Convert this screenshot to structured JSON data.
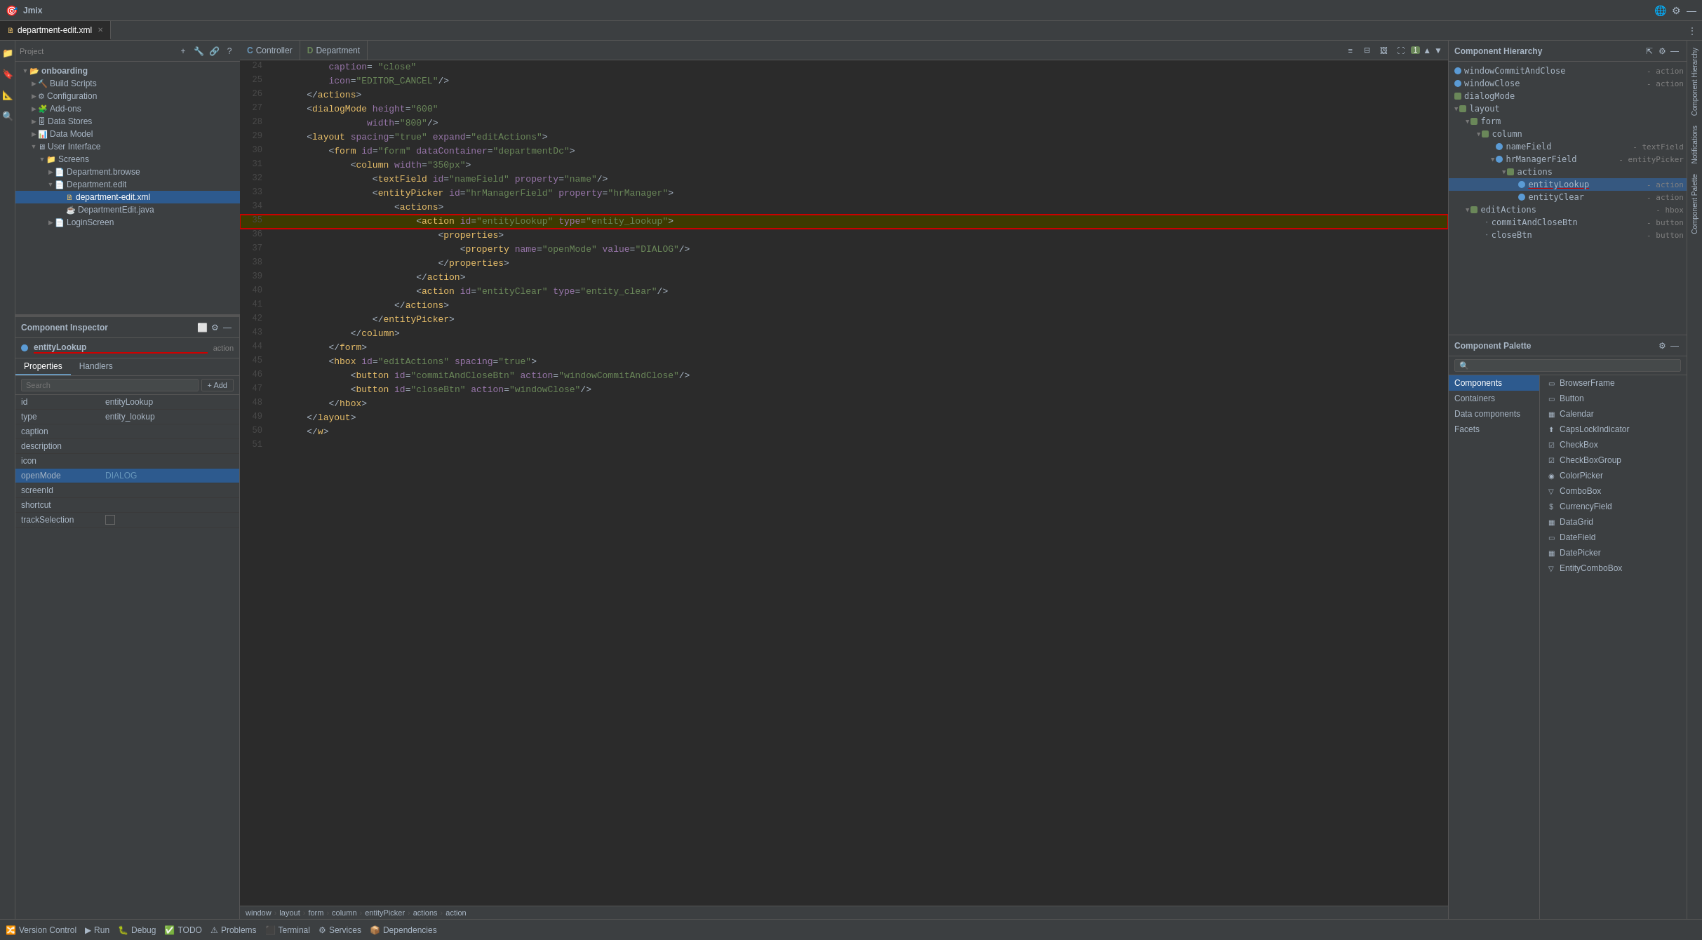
{
  "app": {
    "title": "Jmix",
    "tab_title": "department-edit.xml"
  },
  "top_bar": {
    "title": "Jmix",
    "buttons": [
      "globe-icon",
      "settings-icon",
      "close-icon"
    ]
  },
  "editor_tabs": [
    {
      "label": "Controller",
      "icon": "C",
      "active": false
    },
    {
      "label": "Department",
      "icon": "D",
      "active": false
    }
  ],
  "left_sidebar_icons": [
    "project-icon",
    "bookmark-icon",
    "structure-icon",
    "inspector-icon"
  ],
  "right_sidebar_labels": [
    "Component Hierarchy",
    "Notifications",
    "Component Palette"
  ],
  "project_panel": {
    "title": "Project",
    "toolbar_buttons": [
      "+",
      "wrench",
      "chain",
      "?"
    ],
    "tree": [
      {
        "id": "onboarding",
        "label": "onboarding",
        "level": 0,
        "expanded": true,
        "icon": "folder",
        "bold": true
      },
      {
        "id": "build-scripts",
        "label": "Build Scripts",
        "level": 1,
        "expanded": false,
        "icon": "build"
      },
      {
        "id": "configuration",
        "label": "Configuration",
        "level": 1,
        "expanded": false,
        "icon": "config"
      },
      {
        "id": "add-ons",
        "label": "Add-ons",
        "level": 1,
        "expanded": false,
        "icon": "addon"
      },
      {
        "id": "data-stores",
        "label": "Data Stores",
        "level": 1,
        "expanded": false,
        "icon": "db"
      },
      {
        "id": "data-model",
        "label": "Data Model",
        "level": 1,
        "expanded": false,
        "icon": "model"
      },
      {
        "id": "user-interface",
        "label": "User Interface",
        "level": 1,
        "expanded": true,
        "icon": "ui"
      },
      {
        "id": "screens",
        "label": "Screens",
        "level": 2,
        "expanded": true,
        "icon": "folder"
      },
      {
        "id": "department-browse",
        "label": "Department.browse",
        "level": 3,
        "expanded": false,
        "icon": "screen"
      },
      {
        "id": "department-edit",
        "label": "Department.edit",
        "level": 3,
        "expanded": true,
        "icon": "screen"
      },
      {
        "id": "department-edit-xml",
        "label": "department-edit.xml",
        "level": 4,
        "icon": "xml",
        "selected": true
      },
      {
        "id": "department-edit-java",
        "label": "DepartmentEdit.java",
        "level": 4,
        "icon": "java"
      },
      {
        "id": "login-screen",
        "label": "LoginScreen",
        "level": 3,
        "expanded": false,
        "icon": "screen"
      }
    ]
  },
  "component_inspector": {
    "title": "Component Inspector",
    "component_name": "entityLookup",
    "component_type": "action",
    "tabs": [
      "Properties",
      "Handlers"
    ],
    "active_tab": "Properties",
    "search_placeholder": "Search",
    "add_label": "+ Add",
    "properties": [
      {
        "name": "id",
        "value": "entityLookup",
        "selected": false
      },
      {
        "name": "type",
        "value": "entity_lookup",
        "selected": false
      },
      {
        "name": "caption",
        "value": "",
        "selected": false
      },
      {
        "name": "description",
        "value": "",
        "selected": false
      },
      {
        "name": "icon",
        "value": "",
        "selected": false
      },
      {
        "name": "openMode",
        "value": "DIALOG",
        "selected": true
      },
      {
        "name": "screenId",
        "value": "",
        "selected": false
      },
      {
        "name": "shortcut",
        "value": "",
        "selected": false
      },
      {
        "name": "trackSelection",
        "value": "checkbox",
        "selected": false
      }
    ]
  },
  "code_editor": {
    "file": "department-edit.xml",
    "toolbar_icons": [
      "list-icon",
      "columns-icon",
      "image-icon",
      "zoom-icon"
    ],
    "badge_count": "1",
    "lines": [
      {
        "num": 24,
        "code": "        caption= \"close\"",
        "highlight": false
      },
      {
        "num": 25,
        "code": "        icon=\"EDITOR_CANCEL\"/>",
        "highlight": false
      },
      {
        "num": 26,
        "code": "    </actions>",
        "highlight": false
      },
      {
        "num": 27,
        "code": "    <dialogMode height=\"600\"",
        "highlight": false
      },
      {
        "num": 28,
        "code": "               width=\"800\"/>",
        "highlight": false
      },
      {
        "num": 29,
        "code": "    <layout spacing=\"true\" expand=\"editActions\">",
        "highlight": false
      },
      {
        "num": 30,
        "code": "        <form id=\"form\" dataContainer=\"departmentDc\">",
        "highlight": false
      },
      {
        "num": 31,
        "code": "            <column width=\"350px\">",
        "highlight": false
      },
      {
        "num": 32,
        "code": "                <textField id=\"nameField\" property=\"name\"/>",
        "highlight": false
      },
      {
        "num": 33,
        "code": "                <entityPicker id=\"hrManagerField\" property=\"hrManager\">",
        "highlight": false
      },
      {
        "num": 34,
        "code": "                    <actions>",
        "highlight": false
      },
      {
        "num": 35,
        "code": "                        <action id=\"entityLookup\" type=\"entity_lookup\">",
        "highlight": true,
        "highlight_type": "yellow"
      },
      {
        "num": 36,
        "code": "                            <properties>",
        "highlight": false
      },
      {
        "num": 37,
        "code": "                                <property name=\"openMode\" value=\"DIALOG\"/>",
        "highlight": false
      },
      {
        "num": 38,
        "code": "                            </properties>",
        "highlight": false
      },
      {
        "num": 39,
        "code": "                        </action>",
        "highlight": false
      },
      {
        "num": 40,
        "code": "                        <action id=\"entityClear\" type=\"entity_clear\"/>",
        "highlight": false
      },
      {
        "num": 41,
        "code": "                    </actions>",
        "highlight": false
      },
      {
        "num": 42,
        "code": "                </entityPicker>",
        "highlight": false
      },
      {
        "num": 43,
        "code": "            </column>",
        "highlight": false
      },
      {
        "num": 44,
        "code": "        </form>",
        "highlight": false
      },
      {
        "num": 45,
        "code": "        <hbox id=\"editActions\" spacing=\"true\">",
        "highlight": false
      },
      {
        "num": 46,
        "code": "            <button id=\"commitAndCloseBtn\" action=\"windowCommitAndClose\"/>",
        "highlight": false
      },
      {
        "num": 47,
        "code": "            <button id=\"closeBtn\" action=\"windowClose\"/>",
        "highlight": false
      },
      {
        "num": 48,
        "code": "        </hbox>",
        "highlight": false
      },
      {
        "num": 49,
        "code": "    </layout>",
        "highlight": false
      },
      {
        "num": 50,
        "code": "    </w>",
        "highlight": false
      },
      {
        "num": 51,
        "code": "",
        "highlight": false
      }
    ]
  },
  "breadcrumb": {
    "items": [
      "window",
      "layout",
      "form",
      "column",
      "entityPicker",
      "actions",
      "action"
    ]
  },
  "component_hierarchy": {
    "title": "Component Hierarchy",
    "items": [
      {
        "id": "windowCommitAndClose",
        "label": "windowCommitAndClose",
        "type": "action",
        "level": 0,
        "dot": "blue"
      },
      {
        "id": "windowClose",
        "label": "windowClose",
        "type": "action",
        "level": 0,
        "dot": "blue"
      },
      {
        "id": "dialogMode",
        "label": "dialogMode",
        "type": "",
        "level": 0,
        "dot": "square"
      },
      {
        "id": "layout",
        "label": "layout",
        "type": "",
        "level": 0,
        "expanded": true,
        "dot": "square"
      },
      {
        "id": "form",
        "label": "form",
        "type": "",
        "level": 1,
        "expanded": true,
        "dot": "square"
      },
      {
        "id": "column",
        "label": "column",
        "type": "",
        "level": 2,
        "expanded": true,
        "dot": "square"
      },
      {
        "id": "nameField",
        "label": "nameField",
        "type": "textField",
        "level": 3,
        "dot": "blue"
      },
      {
        "id": "hrManagerField",
        "label": "hrManagerField",
        "type": "entityPicker",
        "level": 3,
        "expanded": true,
        "dot": "blue"
      },
      {
        "id": "actions",
        "label": "actions",
        "type": "",
        "level": 4,
        "expanded": true,
        "dot": "square"
      },
      {
        "id": "entityLookup",
        "label": "entityLookup",
        "type": "action",
        "level": 5,
        "dot": "blue",
        "selected": true
      },
      {
        "id": "entityClear",
        "label": "entityClear",
        "type": "action",
        "level": 5,
        "dot": "blue"
      },
      {
        "id": "editActions",
        "label": "editActions",
        "type": "hbox",
        "level": 1,
        "expanded": true,
        "dot": "square"
      },
      {
        "id": "commitAndCloseBtn",
        "label": "commitAndCloseBtn",
        "type": "button",
        "level": 2,
        "dot": "blue"
      },
      {
        "id": "closeBtn",
        "label": "closeBtn",
        "type": "button",
        "level": 2,
        "dot": "blue"
      }
    ]
  },
  "component_palette": {
    "title": "Component Palette",
    "search_placeholder": "🔍",
    "categories": [
      "Components",
      "Containers",
      "Data components",
      "Facets"
    ],
    "active_category": "Components",
    "components": [
      {
        "id": "BrowserFrame",
        "label": "BrowserFrame",
        "icon": "▭"
      },
      {
        "id": "Button",
        "label": "Button",
        "icon": "▭"
      },
      {
        "id": "Calendar",
        "label": "Calendar",
        "icon": "▦"
      },
      {
        "id": "CapsLockIndicator",
        "label": "CapsLockIndicator",
        "icon": "⬆"
      },
      {
        "id": "CheckBox",
        "label": "CheckBox",
        "icon": "☑"
      },
      {
        "id": "CheckBoxGroup",
        "label": "CheckBoxGroup",
        "icon": "☑"
      },
      {
        "id": "ColorPicker",
        "label": "ColorPicker",
        "icon": "◉"
      },
      {
        "id": "ComboBox",
        "label": "ComboBox",
        "icon": "▽"
      },
      {
        "id": "CurrencyField",
        "label": "CurrencyField",
        "icon": "$"
      },
      {
        "id": "DataGrid",
        "label": "DataGrid",
        "icon": "▦"
      },
      {
        "id": "DateField",
        "label": "DateField",
        "icon": "▭"
      },
      {
        "id": "DatePicker",
        "label": "DatePicker",
        "icon": "▦"
      },
      {
        "id": "EntityComboBox",
        "label": "EntityComboBox",
        "icon": "▽"
      }
    ]
  },
  "bottom_bar": {
    "items": [
      "Version Control",
      "Run",
      "Debug",
      "TODO",
      "Problems",
      "Terminal",
      "Services",
      "Dependencies"
    ]
  }
}
